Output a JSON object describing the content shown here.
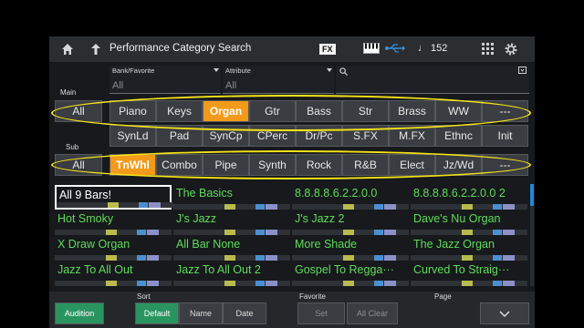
{
  "title_bar": {
    "title": "Performance Category Search",
    "fx_label": "FX",
    "tempo": "♩ 152",
    "icons": [
      "home-icon",
      "back-icon",
      "keyboard-icon",
      "usb-icon",
      "grid-icon",
      "gear-icon"
    ]
  },
  "filters": {
    "bank_label": "Bank/Favorite",
    "bank_value": "All",
    "attribute_label": "Attribute",
    "attribute_value": "All",
    "search_icon": "search-icon"
  },
  "main": {
    "label": "Main",
    "all_label": "All",
    "row1": [
      "Piano",
      "Keys",
      "Organ",
      "Gtr",
      "Bass",
      "Str",
      "Brass",
      "WW",
      "---"
    ],
    "row2": [
      "SynLd",
      "Pad",
      "SynCp",
      "CPerc",
      "Dr/Pc",
      "S.FX",
      "M.FX",
      "Ethnc",
      "Init"
    ],
    "selected": "Organ"
  },
  "sub": {
    "label": "Sub",
    "all_label": "All",
    "items": [
      "TnWhl",
      "Combo",
      "Pipe",
      "Synth",
      "Rock",
      "R&B",
      "Elect",
      "Jz/Wd",
      "---"
    ],
    "selected": "TnWhl"
  },
  "performances": [
    [
      "All 9 Bars!",
      "The Basics",
      "8.8.8.8.6.2.2.0.0",
      "8.8.8.8.6.2.2.0.0 2"
    ],
    [
      "Hot Smoky",
      "J's Jazz",
      "J's Jazz 2",
      "Dave's Nu Organ"
    ],
    [
      "X Draw Organ",
      "All Bar None",
      "More Shade",
      "The Jazz Organ"
    ],
    [
      "Jazz To All Out",
      "Jazz To All Out 2",
      "Gospel To Regga···",
      "Curved To Straig···"
    ]
  ],
  "selected_performance": "All 9 Bars!",
  "bottom": {
    "audition": "Audition",
    "sort_label": "Sort",
    "sort_options": [
      "Default",
      "Name",
      "Date"
    ],
    "favorite_label": "Favorite",
    "favorite_set": "Set",
    "favorite_clear": "All Clear",
    "page_label": "Page"
  },
  "colors": {
    "accent": "#f29a19",
    "annotation": "#f4e31a",
    "name_text": "#5fdc5a",
    "audition": "#2a9460"
  }
}
